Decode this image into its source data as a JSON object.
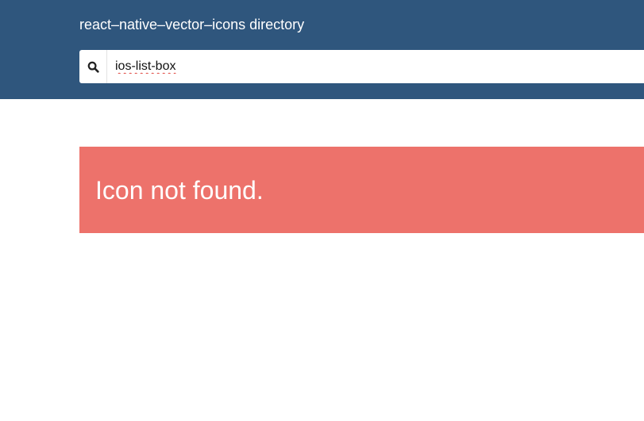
{
  "header": {
    "title": "react–native–vector–icons directory",
    "background": "#2f567d"
  },
  "search": {
    "icon": "search-icon",
    "value": "ios-list-box"
  },
  "alert": {
    "message": "Icon not found.",
    "background": "#ed726b"
  }
}
